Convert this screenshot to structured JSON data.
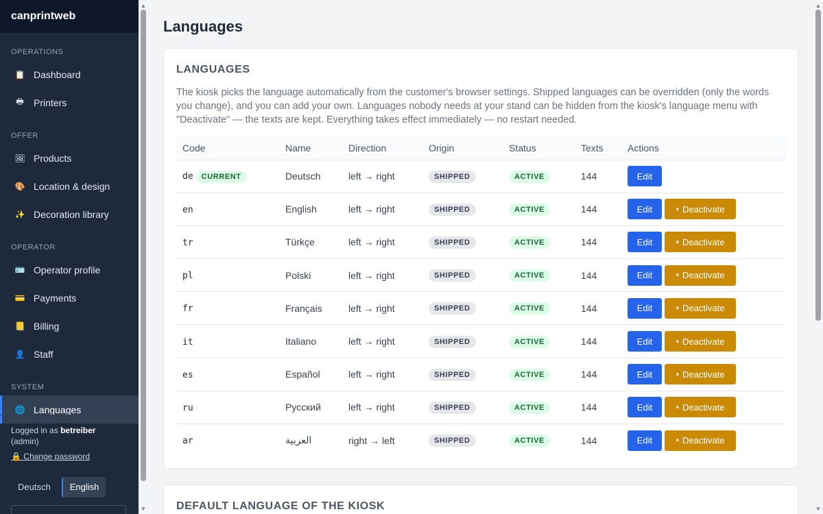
{
  "app": {
    "brand": "canprintweb"
  },
  "sidebar": {
    "sections": [
      {
        "title": "OPERATIONS",
        "items": [
          {
            "label": "Dashboard",
            "icon": "clipboard-icon",
            "glyph": "📋"
          },
          {
            "label": "Printers",
            "icon": "printer-icon",
            "glyph": "🖶"
          }
        ]
      },
      {
        "title": "OFFER",
        "items": [
          {
            "label": "Products",
            "icon": "frame-icon",
            "glyph": "🖼"
          },
          {
            "label": "Location & design",
            "icon": "palette-icon",
            "glyph": "🎨"
          },
          {
            "label": "Decoration library",
            "icon": "sparkles-icon",
            "glyph": "✨"
          }
        ]
      },
      {
        "title": "OPERATOR",
        "items": [
          {
            "label": "Operator profile",
            "icon": "id-card-icon",
            "glyph": "🪪"
          },
          {
            "label": "Payments",
            "icon": "credit-card-icon",
            "glyph": "💳"
          },
          {
            "label": "Billing",
            "icon": "ledger-icon",
            "glyph": "📒"
          },
          {
            "label": "Staff",
            "icon": "person-icon",
            "glyph": "👤"
          }
        ]
      },
      {
        "title": "SYSTEM",
        "items": [
          {
            "label": "Languages",
            "icon": "globe-icon",
            "glyph": "🌐",
            "active": true
          }
        ]
      }
    ],
    "footer": {
      "logged_in_prefix": "Logged in as ",
      "username": "betreiber",
      "role": "(admin)",
      "change_password": "Change password",
      "lock_glyph": "🔒"
    },
    "language_switch": {
      "options": [
        "Deutsch",
        "English"
      ],
      "selected": "English"
    }
  },
  "page": {
    "title": "Languages"
  },
  "languages_card": {
    "heading": "LANGUAGES",
    "description": "The kiosk picks the language automatically from the customer's browser settings. Shipped languages can be overridden (only the words you change), and you can add your own. Languages nobody needs at your stand can be hidden from the kiosk's language menu with \"Deactivate\" — the texts are kept. Everything takes effect immediately — no restart needed.",
    "columns": [
      "Code",
      "Name",
      "Direction",
      "Origin",
      "Status",
      "Texts",
      "Actions"
    ],
    "current_label": "CURRENT",
    "edit_label": "Edit",
    "deactivate_label": "Deactivate",
    "pause_glyph": "⏸",
    "rows": [
      {
        "code": "de",
        "name": "Deutsch",
        "direction": "left → right",
        "origin": "SHIPPED",
        "status": "ACTIVE",
        "texts": "144",
        "current": true
      },
      {
        "code": "en",
        "name": "English",
        "direction": "left → right",
        "origin": "SHIPPED",
        "status": "ACTIVE",
        "texts": "144"
      },
      {
        "code": "tr",
        "name": "Türkçe",
        "direction": "left → right",
        "origin": "SHIPPED",
        "status": "ACTIVE",
        "texts": "144"
      },
      {
        "code": "pl",
        "name": "Polski",
        "direction": "left → right",
        "origin": "SHIPPED",
        "status": "ACTIVE",
        "texts": "144"
      },
      {
        "code": "fr",
        "name": "Français",
        "direction": "left → right",
        "origin": "SHIPPED",
        "status": "ACTIVE",
        "texts": "144"
      },
      {
        "code": "it",
        "name": "Italiano",
        "direction": "left → right",
        "origin": "SHIPPED",
        "status": "ACTIVE",
        "texts": "144"
      },
      {
        "code": "es",
        "name": "Español",
        "direction": "left → right",
        "origin": "SHIPPED",
        "status": "ACTIVE",
        "texts": "144"
      },
      {
        "code": "ru",
        "name": "Русский",
        "direction": "left → right",
        "origin": "SHIPPED",
        "status": "ACTIVE",
        "texts": "144"
      },
      {
        "code": "ar",
        "name": "العربية",
        "direction": "right → left",
        "origin": "SHIPPED",
        "status": "ACTIVE",
        "texts": "144"
      }
    ]
  },
  "default_language_card": {
    "heading": "DEFAULT LANGUAGE OF THE KIOSK"
  }
}
